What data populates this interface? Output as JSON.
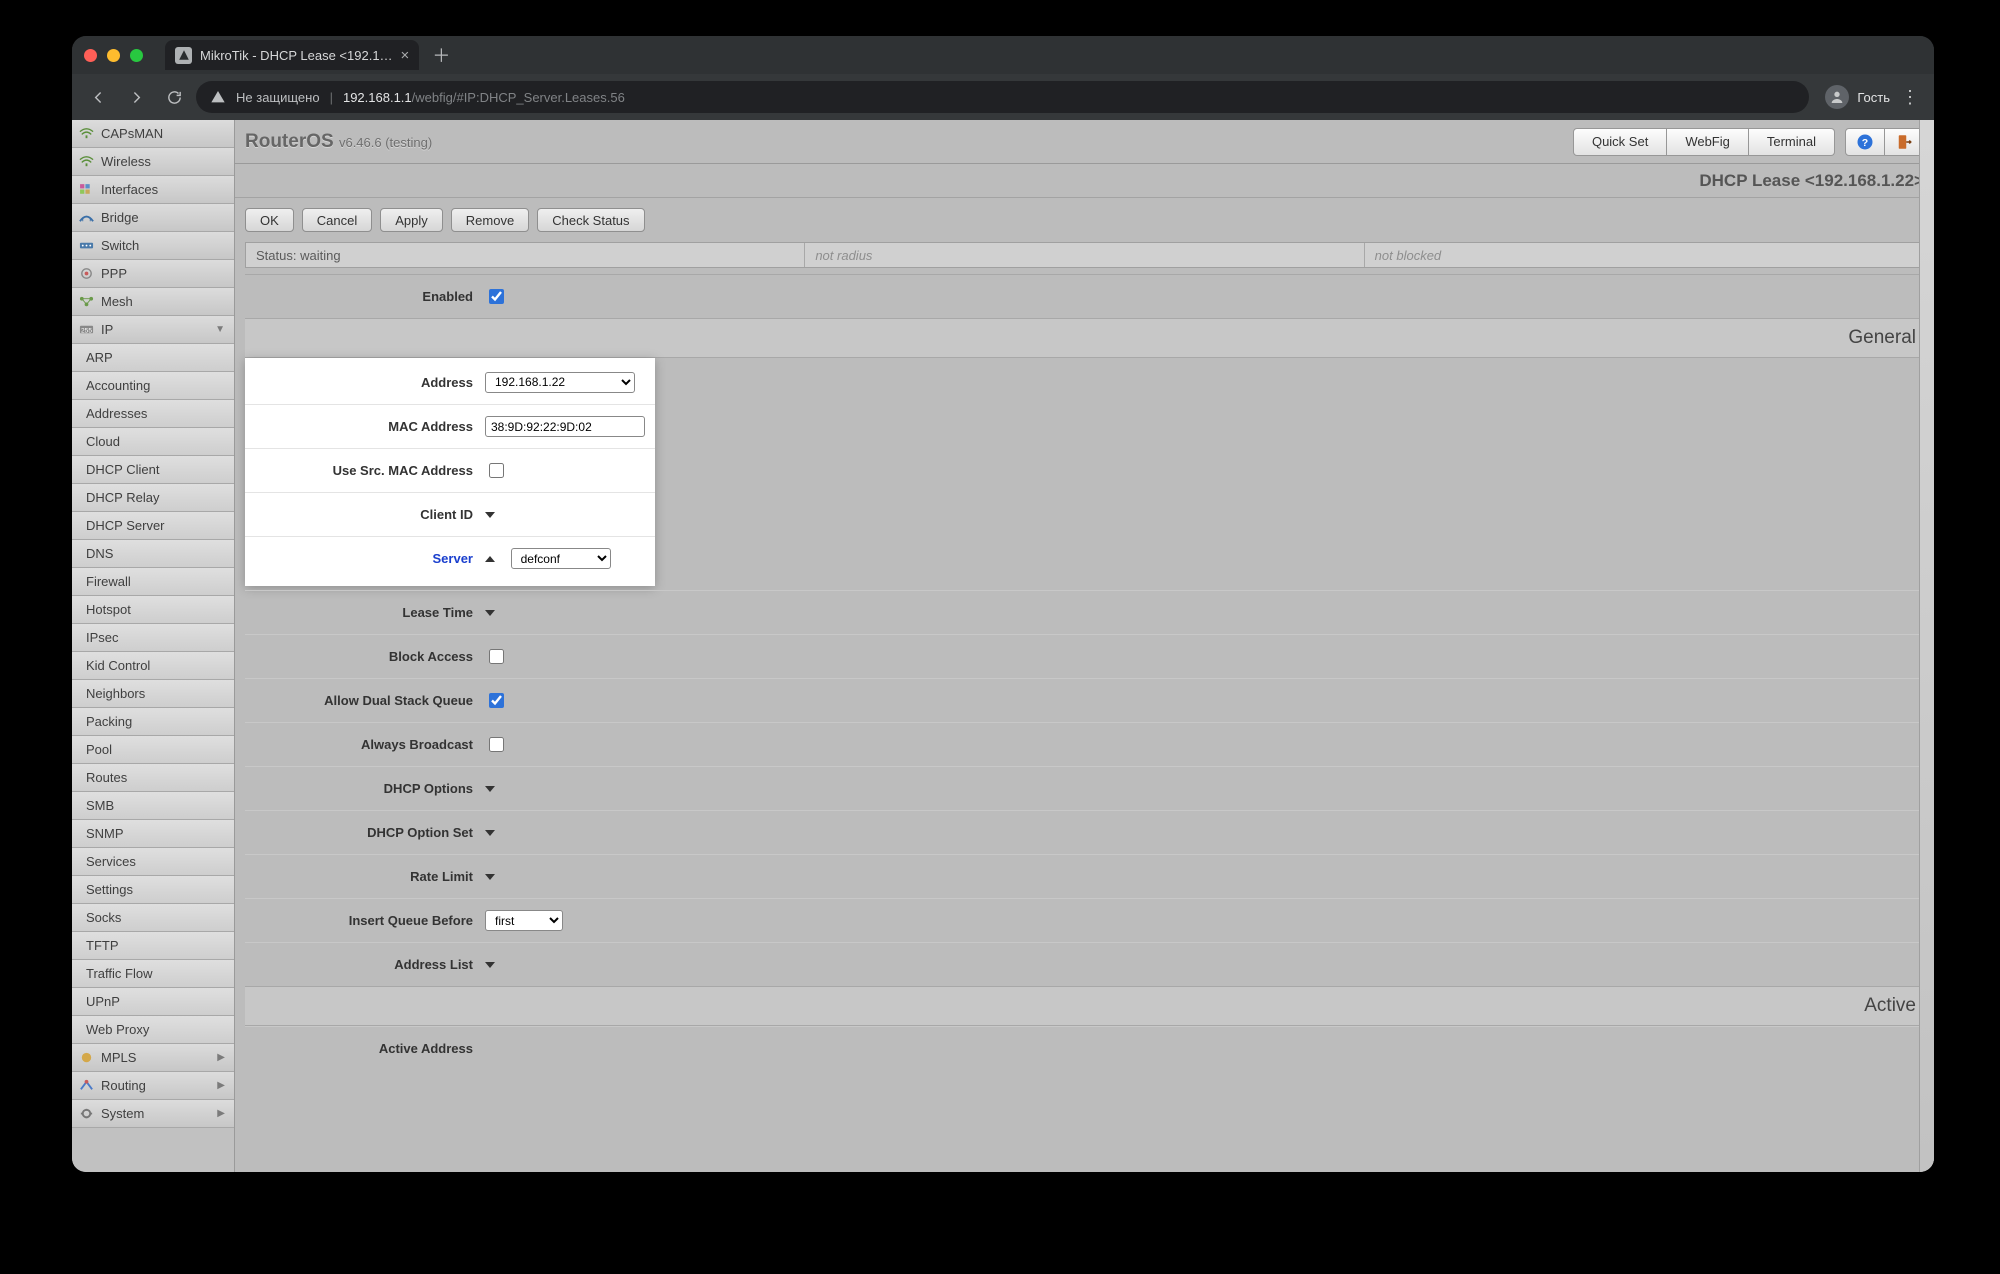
{
  "browser": {
    "tab_title": "MikroTik - DHCP Lease <192.1…",
    "not_secure": "Не защищено",
    "host": "192.168.1.1",
    "path": "/webfig/#IP:DHCP_Server.Leases.56",
    "guest_label": "Гость"
  },
  "header": {
    "brand": "RouterOS",
    "version": "v6.46.6 (testing)",
    "buttons": {
      "quickset": "Quick Set",
      "webfig": "WebFig",
      "terminal": "Terminal"
    },
    "crumb": "DHCP Lease <192.168.1.22>"
  },
  "actions": {
    "ok": "OK",
    "cancel": "Cancel",
    "apply": "Apply",
    "remove": "Remove",
    "check": "Check Status"
  },
  "status": {
    "main": "Status: waiting",
    "radius": "not radius",
    "blocked": "not blocked"
  },
  "sections": {
    "general": "General",
    "active": "Active"
  },
  "form": {
    "enabled": {
      "label": "Enabled",
      "checked": true
    },
    "address": {
      "label": "Address",
      "value": "192.168.1.22"
    },
    "mac": {
      "label": "MAC Address",
      "value": "38:9D:92:22:9D:02"
    },
    "use_src_mac": {
      "label": "Use Src. MAC Address",
      "checked": false
    },
    "client_id": {
      "label": "Client ID"
    },
    "server": {
      "label": "Server",
      "value": "defconf"
    },
    "lease_time": {
      "label": "Lease Time"
    },
    "block_access": {
      "label": "Block Access",
      "checked": false
    },
    "dual_stack": {
      "label": "Allow Dual Stack Queue",
      "checked": true
    },
    "always_broadcast": {
      "label": "Always Broadcast",
      "checked": false
    },
    "dhcp_options": {
      "label": "DHCP Options"
    },
    "dhcp_option_set": {
      "label": "DHCP Option Set"
    },
    "rate_limit": {
      "label": "Rate Limit"
    },
    "insert_queue": {
      "label": "Insert Queue Before",
      "value": "first"
    },
    "address_list": {
      "label": "Address List"
    },
    "active_address": {
      "label": "Active Address"
    }
  },
  "sidebar": {
    "items": [
      {
        "label": "CAPsMAN",
        "icon": "wifi"
      },
      {
        "label": "Wireless",
        "icon": "wifi"
      },
      {
        "label": "Interfaces",
        "icon": "grid"
      },
      {
        "label": "Bridge",
        "icon": "bridge"
      },
      {
        "label": "Switch",
        "icon": "switch"
      },
      {
        "label": "PPP",
        "icon": "ppp"
      },
      {
        "label": "Mesh",
        "icon": "mesh"
      },
      {
        "label": "IP",
        "icon": "ip",
        "expand": true,
        "open": true
      },
      {
        "label": "ARP",
        "child": true
      },
      {
        "label": "Accounting",
        "child": true
      },
      {
        "label": "Addresses",
        "child": true
      },
      {
        "label": "Cloud",
        "child": true
      },
      {
        "label": "DHCP Client",
        "child": true
      },
      {
        "label": "DHCP Relay",
        "child": true
      },
      {
        "label": "DHCP Server",
        "child": true
      },
      {
        "label": "DNS",
        "child": true
      },
      {
        "label": "Firewall",
        "child": true
      },
      {
        "label": "Hotspot",
        "child": true
      },
      {
        "label": "IPsec",
        "child": true
      },
      {
        "label": "Kid Control",
        "child": true
      },
      {
        "label": "Neighbors",
        "child": true
      },
      {
        "label": "Packing",
        "child": true
      },
      {
        "label": "Pool",
        "child": true
      },
      {
        "label": "Routes",
        "child": true
      },
      {
        "label": "SMB",
        "child": true
      },
      {
        "label": "SNMP",
        "child": true
      },
      {
        "label": "Services",
        "child": true
      },
      {
        "label": "Settings",
        "child": true
      },
      {
        "label": "Socks",
        "child": true
      },
      {
        "label": "TFTP",
        "child": true
      },
      {
        "label": "Traffic Flow",
        "child": true
      },
      {
        "label": "UPnP",
        "child": true
      },
      {
        "label": "Web Proxy",
        "child": true
      },
      {
        "label": "MPLS",
        "icon": "mpls",
        "expand": true
      },
      {
        "label": "Routing",
        "icon": "routing",
        "expand": true
      },
      {
        "label": "System",
        "icon": "system",
        "expand": true
      }
    ]
  }
}
